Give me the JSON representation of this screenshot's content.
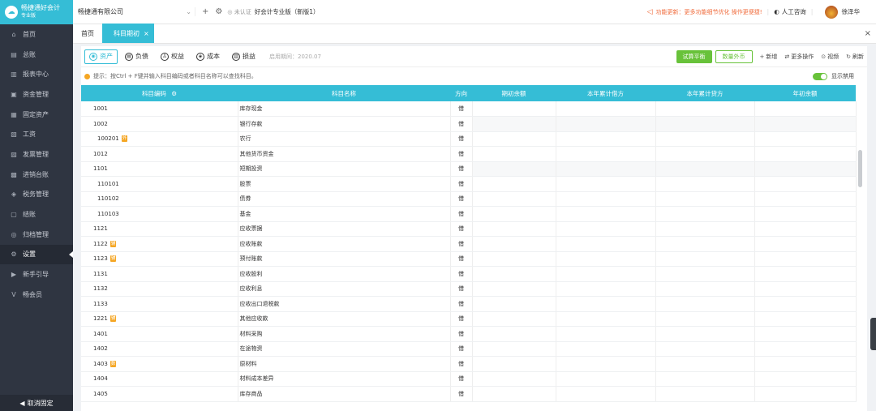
{
  "app": {
    "name": "畅捷通好会计",
    "edition": "专业版"
  },
  "sidebar": {
    "items": [
      {
        "label": "首页",
        "icon": "home-icon",
        "glyph": "⌂"
      },
      {
        "label": "总账",
        "icon": "ledger-icon",
        "glyph": "▤"
      },
      {
        "label": "报表中心",
        "icon": "chart-icon",
        "glyph": "▥"
      },
      {
        "label": "资金管理",
        "icon": "wallet-icon",
        "glyph": "▣"
      },
      {
        "label": "固定资产",
        "icon": "asset-icon",
        "glyph": "▦"
      },
      {
        "label": "工资",
        "icon": "salary-icon",
        "glyph": "▧"
      },
      {
        "label": "发票管理",
        "icon": "invoice-icon",
        "glyph": "▨"
      },
      {
        "label": "进销台账",
        "icon": "inventory-icon",
        "glyph": "▩"
      },
      {
        "label": "税务管理",
        "icon": "tax-icon",
        "glyph": "◈"
      },
      {
        "label": "结账",
        "icon": "close-books-icon",
        "glyph": "▢"
      },
      {
        "label": "归档管理",
        "icon": "archive-icon",
        "glyph": "◎"
      },
      {
        "label": "设置",
        "icon": "gear-icon",
        "glyph": "⚙"
      },
      {
        "label": "新手引导",
        "icon": "guide-icon",
        "glyph": "▶"
      },
      {
        "label": "畅会员",
        "icon": "vip-icon",
        "glyph": "V"
      }
    ],
    "active_index": 11,
    "footer": "取消固定"
  },
  "topbar": {
    "company": "畅捷通有限公司",
    "verify": "未认证",
    "version": "好会计专业版（新版1）",
    "notice": "功能更新：更多功能细节优化 操作更便捷!",
    "consult": "人工咨询",
    "user": "徐泽华"
  },
  "tabs": [
    {
      "label": "首页",
      "active": false
    },
    {
      "label": "科目期初",
      "active": true
    }
  ],
  "toolbar": {
    "types": [
      {
        "label": "资产",
        "glyph": "◉"
      },
      {
        "label": "负债",
        "glyph": "▤"
      },
      {
        "label": "权益",
        "glyph": "♙"
      },
      {
        "label": "成本",
        "glyph": "◈"
      },
      {
        "label": "损益",
        "glyph": "▥"
      }
    ],
    "enable_date": "启用期间：2020.07",
    "trial_balance": "试算平衡",
    "foreign_currency": "数量外币",
    "add": "新增",
    "more": "更多操作",
    "video": "视频",
    "refresh": "刷新"
  },
  "hint": "提示：按Ctrl + F键并输入科目编码或者科目名称可以查找科目。",
  "toggle_label": "显示禁用",
  "table": {
    "headers": [
      "科目编码",
      "科目名称",
      "方向",
      "期初余额",
      "本年累计借方",
      "本年累计贷方",
      "年初余额"
    ],
    "rows": [
      {
        "code": "1001",
        "badge": "",
        "name": "库存现金",
        "dir": "借",
        "sub": false
      },
      {
        "code": "1002",
        "badge": "",
        "name": "银行存款",
        "dir": "借",
        "sub": false
      },
      {
        "code": "100201",
        "badge": "外",
        "name": "农行",
        "dir": "借",
        "sub": true
      },
      {
        "code": "1012",
        "badge": "",
        "name": "其他货币资金",
        "dir": "借",
        "sub": false
      },
      {
        "code": "1101",
        "badge": "",
        "name": "短期投资",
        "dir": "借",
        "sub": false
      },
      {
        "code": "110101",
        "badge": "",
        "name": "股票",
        "dir": "借",
        "sub": true
      },
      {
        "code": "110102",
        "badge": "",
        "name": "债券",
        "dir": "借",
        "sub": true
      },
      {
        "code": "110103",
        "badge": "",
        "name": "基金",
        "dir": "借",
        "sub": true
      },
      {
        "code": "1121",
        "badge": "",
        "name": "应收票据",
        "dir": "借",
        "sub": false
      },
      {
        "code": "1122",
        "badge": "辅",
        "name": "应收账款",
        "dir": "借",
        "sub": false
      },
      {
        "code": "1123",
        "badge": "辅",
        "name": "预付账款",
        "dir": "借",
        "sub": false
      },
      {
        "code": "1131",
        "badge": "",
        "name": "应收股利",
        "dir": "借",
        "sub": false
      },
      {
        "code": "1132",
        "badge": "",
        "name": "应收利息",
        "dir": "借",
        "sub": false
      },
      {
        "code": "1133",
        "badge": "",
        "name": "应收出口退税款",
        "dir": "借",
        "sub": false
      },
      {
        "code": "1221",
        "badge": "辅",
        "name": "其他应收款",
        "dir": "借",
        "sub": false
      },
      {
        "code": "1401",
        "badge": "",
        "name": "材料采购",
        "dir": "借",
        "sub": false
      },
      {
        "code": "1402",
        "badge": "",
        "name": "在途物资",
        "dir": "借",
        "sub": false
      },
      {
        "code": "1403",
        "badge": "数",
        "name": "原材料",
        "dir": "借",
        "sub": false
      },
      {
        "code": "1404",
        "badge": "",
        "name": "材料成本差异",
        "dir": "借",
        "sub": false
      },
      {
        "code": "1405",
        "badge": "",
        "name": "库存商品",
        "dir": "借",
        "sub": false
      }
    ],
    "shaded_rows": [
      1,
      4
    ]
  }
}
